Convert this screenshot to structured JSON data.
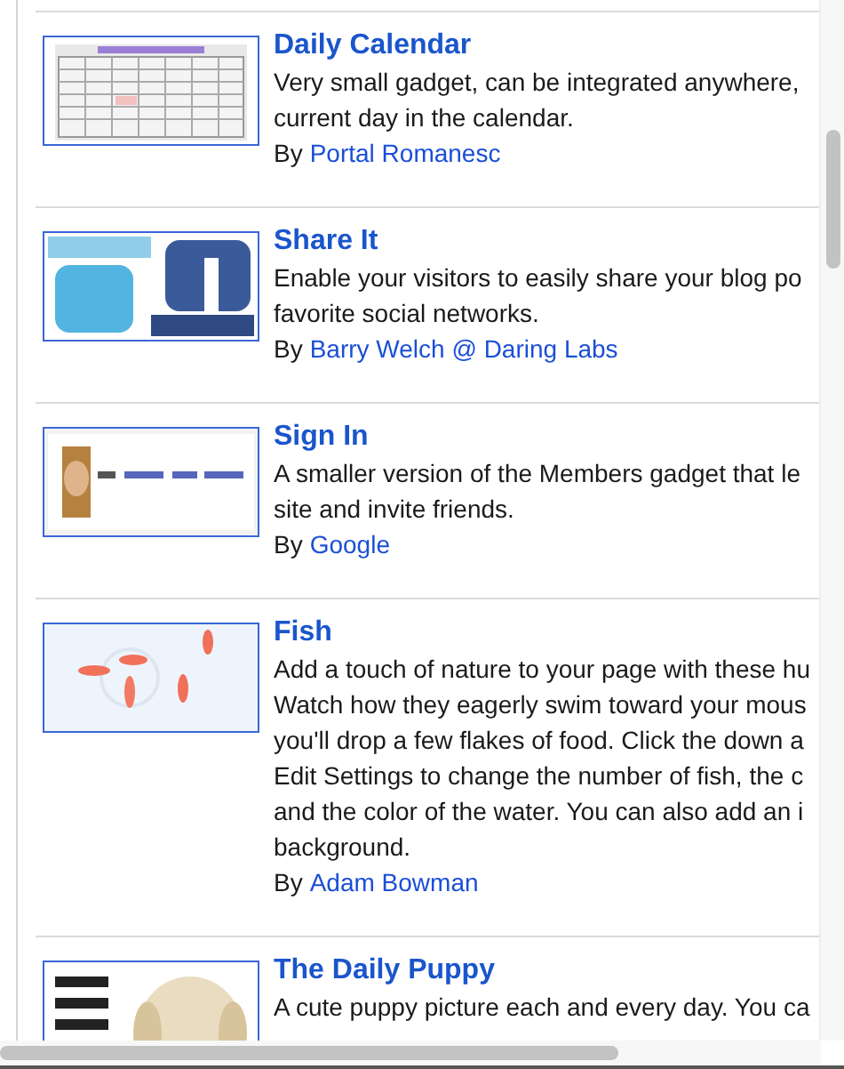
{
  "gadgets": [
    {
      "title": "Daily Calendar",
      "description": [
        "Very small gadget, can be integrated anywhere,",
        "current day in the calendar."
      ],
      "author_prefix": "By",
      "author": "Portal Romanesc",
      "thumbnail": {
        "kind": "picture"
      }
    },
    {
      "title": "Share It",
      "description": [
        "Enable your visitors to easily share your blog po",
        "favorite social networks."
      ],
      "author_prefix": "By",
      "author": "Barry Welch @ Daring Labs",
      "thumbnail": {
        "kind": "picture"
      }
    },
    {
      "title": "Sign In",
      "description": [
        "A smaller version of the Members gadget that le",
        "site and invite friends."
      ],
      "author_prefix": "By",
      "author": "Google",
      "thumbnail": {
        "kind": "picture"
      }
    },
    {
      "title": "Fish",
      "description": [
        "Add a touch of nature to your page with these hu",
        "Watch how they eagerly swim toward your mous",
        "you'll drop a few flakes of food. Click the down a",
        "Edit Settings to change the number of fish, the c",
        "and the color of the water. You can also add an i",
        "background."
      ],
      "author_prefix": "By",
      "author": "Adam Bowman",
      "thumbnail": {
        "kind": "picture"
      }
    },
    {
      "title": "The Daily Puppy",
      "description": [
        "A cute puppy picture each and every day. You ca"
      ],
      "thumbnail": {
        "kind": "picture"
      }
    }
  ]
}
